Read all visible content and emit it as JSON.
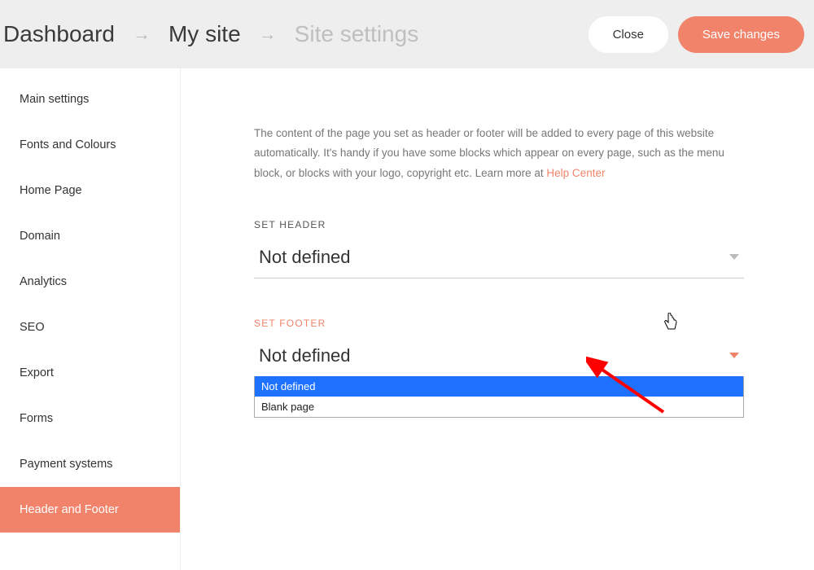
{
  "breadcrumb": {
    "items": [
      "Dashboard",
      "My site",
      "Site settings"
    ]
  },
  "buttons": {
    "close": "Close",
    "save": "Save changes"
  },
  "sidebar": {
    "items": [
      "Main settings",
      "Fonts and Colours",
      "Home Page",
      "Domain",
      "Analytics",
      "SEO",
      "Export",
      "Forms",
      "Payment systems",
      "Header and Footer"
    ],
    "active_index": 9
  },
  "main": {
    "description_pre": "The content of the page you set as header or footer will be added to every page of this website automatically. It's handy if you have some blocks which appear on every page, such as the menu block, or blocks with your logo, copyright etc. Learn more at ",
    "help_link": "Help Center",
    "header_field": {
      "label": "SET HEADER",
      "value": "Not defined"
    },
    "footer_field": {
      "label": "SET FOOTER",
      "value": "Not defined",
      "options": [
        "Not defined",
        "Blank page"
      ],
      "highlighted_option_index": 0
    }
  }
}
